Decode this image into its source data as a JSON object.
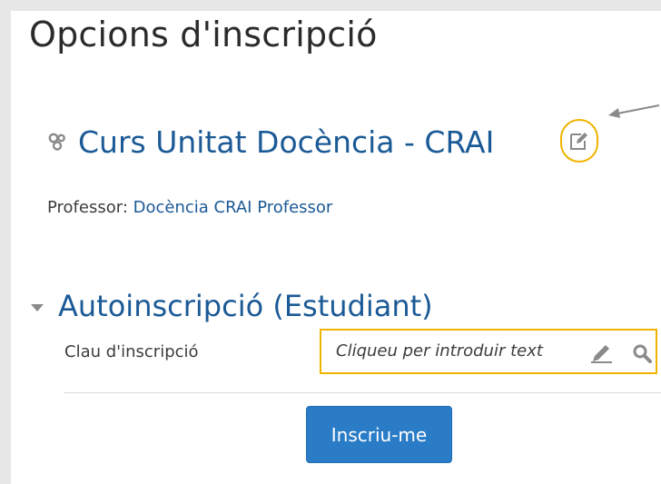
{
  "page": {
    "title": "Opcions d'inscripció"
  },
  "course": {
    "name": "Curs Unitat Docència - CRAI",
    "icon": "course-icon",
    "edit_icon": "edit-icon",
    "teacher_label": "Professor: ",
    "teacher_name": "Docència CRAI Professor"
  },
  "enrolment": {
    "section_title": "Autoinscripció (Estudiant)",
    "key_label": "Clau d'inscripció",
    "key_placeholder": "Cliqueu per introduir text",
    "submit_label": "Inscriu-me"
  },
  "colors": {
    "link": "#1b5a96",
    "highlight": "#f0b400",
    "button": "#2a7cc7"
  }
}
